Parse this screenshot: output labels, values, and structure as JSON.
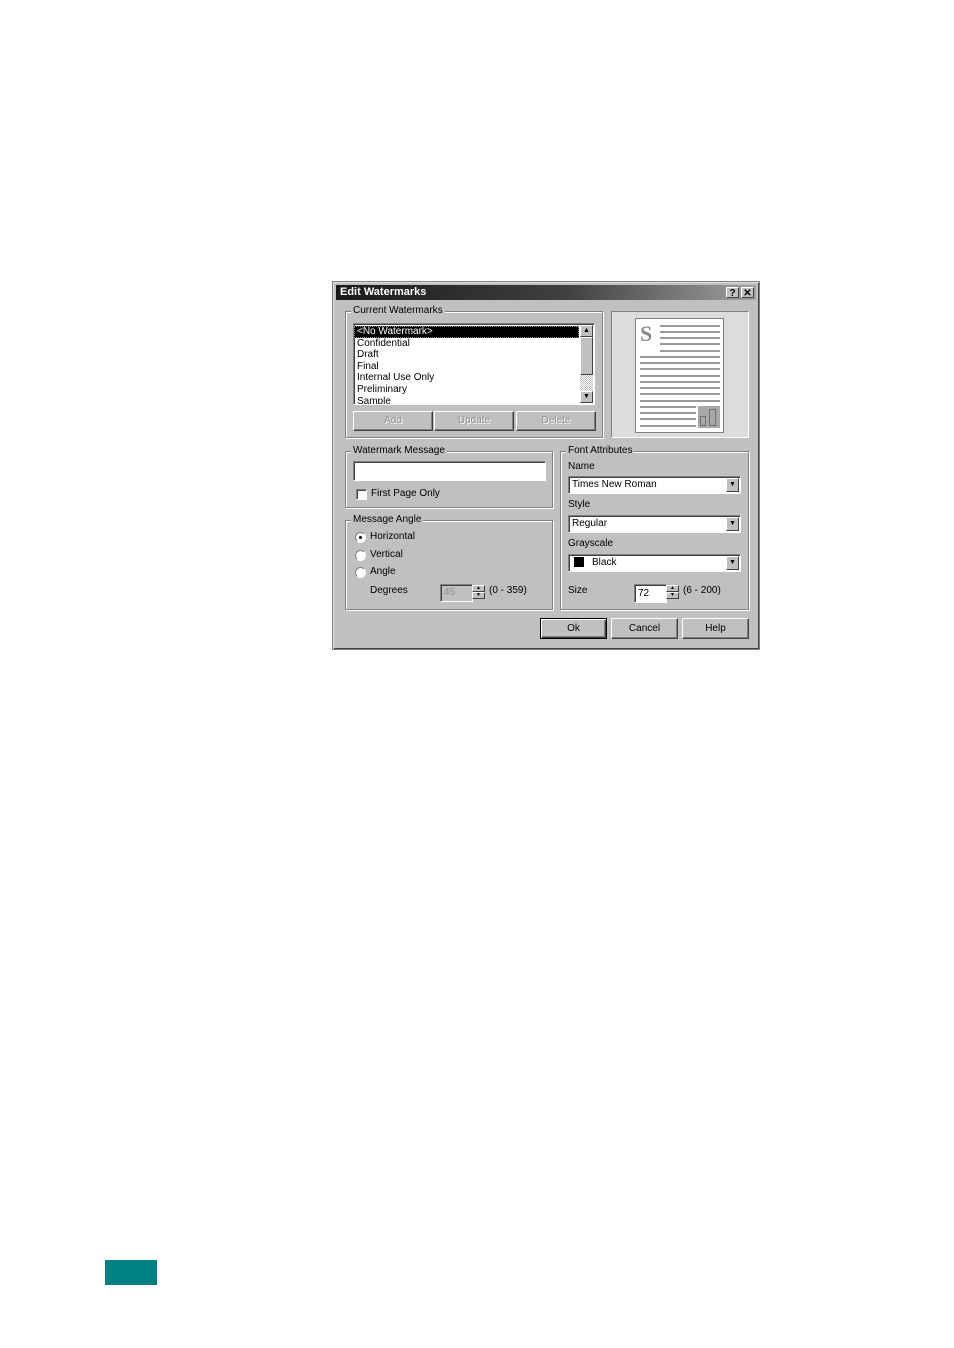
{
  "dialog": {
    "title": "Edit Watermarks",
    "help_button": "?",
    "close_button": "✕",
    "current_watermarks": {
      "label": "Current Watermarks",
      "items": [
        "<No Watermark>",
        "Confidential",
        "Draft",
        "Final",
        "Internal Use Only",
        "Preliminary",
        "Sample"
      ],
      "selected_index": 0,
      "add_label": "Add",
      "update_label": "Update",
      "delete_label": "Delete"
    },
    "watermark_message": {
      "label": "Watermark Message",
      "value": "",
      "first_page_only_label": "First Page Only",
      "first_page_only_checked": false
    },
    "message_angle": {
      "label": "Message Angle",
      "options": [
        "Horizontal",
        "Vertical",
        "Angle"
      ],
      "selected": "Horizontal",
      "degrees_label": "Degrees",
      "degrees_value": "45",
      "degrees_range": "(0 - 359)"
    },
    "font_attributes": {
      "label": "Font Attributes",
      "name_label": "Name",
      "name_value": "Times New Roman",
      "style_label": "Style",
      "style_value": "Regular",
      "grayscale_label": "Grayscale",
      "grayscale_value": "Black",
      "grayscale_color": "#000000",
      "size_label": "Size",
      "size_value": "72",
      "size_range": "(6 - 200)"
    },
    "preview": {
      "watermark_letter": "S"
    },
    "ok_label": "Ok",
    "cancel_label": "Cancel",
    "help_label": "Help"
  },
  "page_footer": {
    "accent_color": "#008080"
  }
}
